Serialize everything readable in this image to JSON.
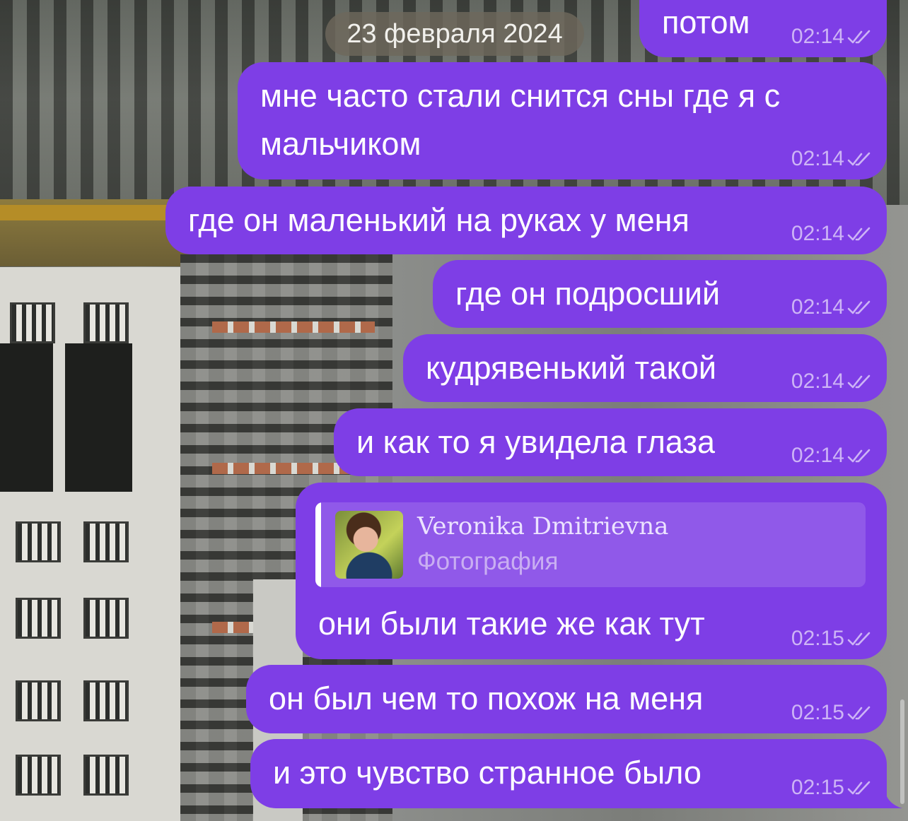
{
  "chat": {
    "date_label": "23 февраля 2024",
    "colors": {
      "bubble": "#7e3ee6",
      "meta": "#cdb4f6",
      "date_pill": "#6e685c"
    },
    "status_icon": "double-check-icon",
    "messages": [
      {
        "text": "потом",
        "time": "02:14"
      },
      {
        "text_lines": [
          "мне часто стали снится сны где я с",
          "мальчиком"
        ],
        "time": "02:14"
      },
      {
        "text": "где он маленький на руках у меня",
        "time": "02:14"
      },
      {
        "text": "где он подросший",
        "time": "02:14"
      },
      {
        "text": "кудрявенький такой",
        "time": "02:14"
      },
      {
        "text": "и как то я увидела глаза",
        "time": "02:14"
      },
      {
        "reply": {
          "author": "Veronika Dmitrievna",
          "type": "Фотография"
        },
        "text": "они были такие же как тут",
        "time": "02:15"
      },
      {
        "text": "он был чем то похож на меня",
        "time": "02:15"
      },
      {
        "text": "и это чувство странное было",
        "time": "02:15"
      }
    ]
  }
}
